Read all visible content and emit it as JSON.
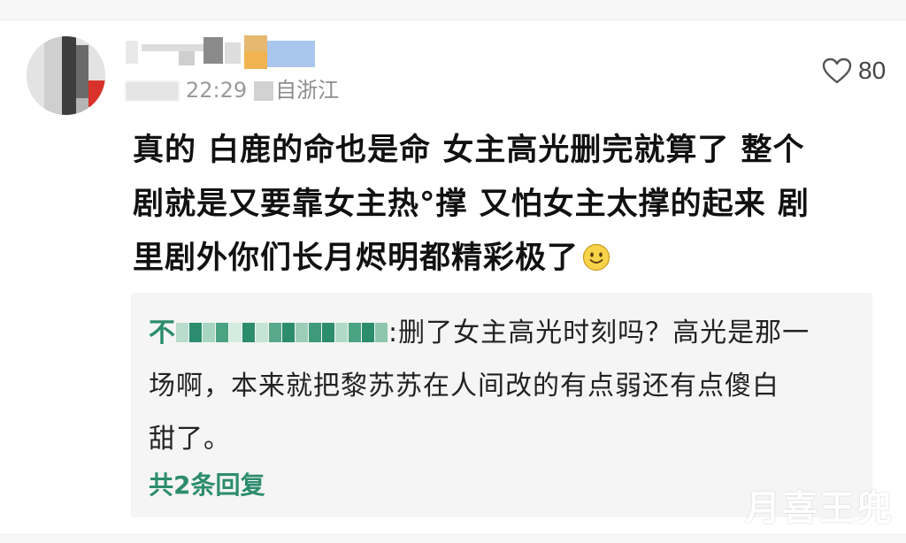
{
  "comment": {
    "username_hidden": true,
    "time": "22:29",
    "location": "自浙江",
    "likes": "80",
    "lines": [
      "真的 白鹿的命也是命 女主高光删完就算了 整个",
      "剧就是又要靠女主热°撑 又怕女主太撑的起来 剧",
      "里剧外你们长月烬明都精彩极了"
    ],
    "emoji": "smile-emoji"
  },
  "reply": {
    "separator": ":",
    "lines": [
      "删了女主高光时刻吗？高光是那一",
      "场啊，本来就把黎苏苏在人间改的有点弱还有点傻白",
      "甜了。"
    ],
    "more_label": "共2条回复"
  },
  "watermark": "月喜王兜",
  "colors": {
    "accent_green": "#2c8c6e",
    "text": "#111111",
    "meta_gray": "#8d8d8d",
    "reply_bg": "#f5f5f5"
  }
}
